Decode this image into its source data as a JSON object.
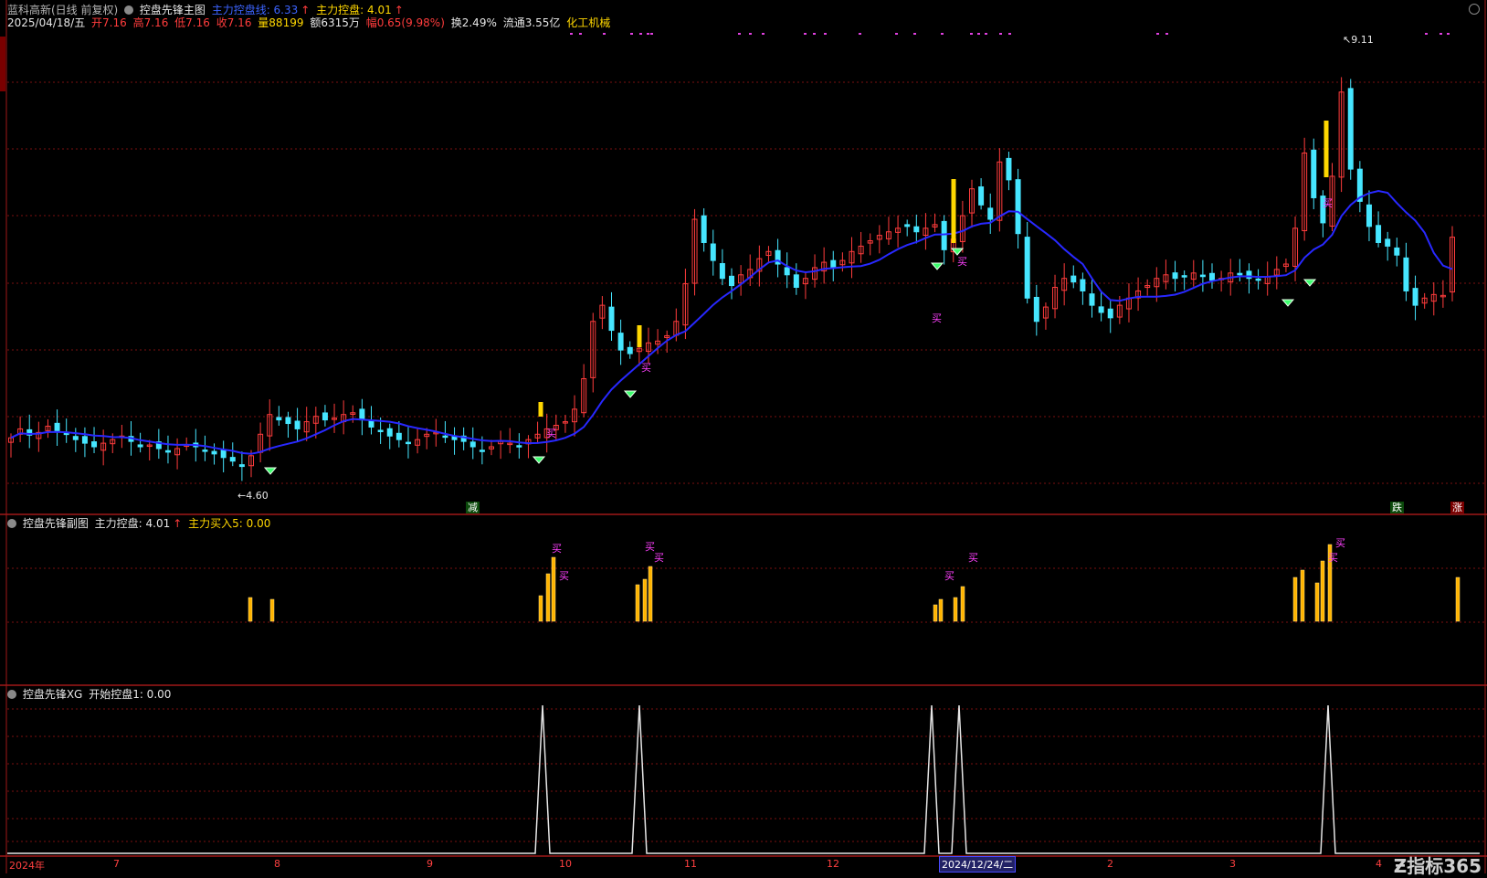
{
  "header": {
    "stock": "蓝科高新(日线 前复权)",
    "main_indicator": "控盘先锋主图",
    "line_label": "主力控盘线: 6.33",
    "kongpan_label": "主力控盘: 4.01",
    "date": "2025/04/18/五",
    "open": "开7.16",
    "high": "高7.16",
    "low": "低7.16",
    "close": "收7.16",
    "volume": "量88199",
    "amount": "额6315万",
    "change": "幅0.65(9.98%)",
    "turnover": "换2.49%",
    "float": "流通3.55亿",
    "industry": "化工机械"
  },
  "sub1": {
    "title": "控盘先锋副图",
    "kongpan": "主力控盘: 4.01",
    "buy5": "主力买入5: 0.00"
  },
  "sub2": {
    "title": "控盘先锋XG",
    "start": "开始控盘1: 0.00"
  },
  "annotations": {
    "low": "4.60",
    "high": "9.11",
    "buy": "买",
    "jian": "减",
    "die": "跌",
    "zhang": "涨"
  },
  "x_axis": {
    "labels": [
      "2024年",
      "7",
      "8",
      "9",
      "10",
      "11",
      "12",
      "2",
      "3",
      "4"
    ],
    "selected": "2024/12/24/二"
  },
  "watermark": "指标365",
  "colors": {
    "up": "#ff3c3c",
    "down": "#46e6ff",
    "ma": "#2828ff",
    "grid": "#7a1010"
  },
  "chart_data": {
    "type": "candlestick",
    "title": "蓝科高新(日线 前复权)",
    "ylim": [
      4.3,
      9.4
    ],
    "closes": [
      4.92,
      5.02,
      4.95,
      4.98,
      5.05,
      5.0,
      4.96,
      4.9,
      4.86,
      4.82,
      4.86,
      4.9,
      4.94,
      4.88,
      4.82,
      4.84,
      4.8,
      4.76,
      4.8,
      4.84,
      4.82,
      4.78,
      4.74,
      4.7,
      4.66,
      4.6,
      4.72,
      4.96,
      5.18,
      5.12,
      5.08,
      5.02,
      5.1,
      5.16,
      5.12,
      5.14,
      5.18,
      5.2,
      5.12,
      5.04,
      5.0,
      4.94,
      4.9,
      4.86,
      4.9,
      4.96,
      4.98,
      4.94,
      4.9,
      4.88,
      4.82,
      4.78,
      4.82,
      4.88,
      4.86,
      4.82,
      4.9,
      4.96,
      5.02,
      5.06,
      5.1,
      5.24,
      5.58,
      6.22,
      6.4,
      6.12,
      5.9,
      5.86,
      5.92,
      5.98,
      6.0,
      6.06,
      6.22,
      6.64,
      7.36,
      7.1,
      6.9,
      6.7,
      6.62,
      6.74,
      6.8,
      6.92,
      7.0,
      6.86,
      6.74,
      6.6,
      6.7,
      6.82,
      6.88,
      6.82,
      6.9,
      7.0,
      7.06,
      7.12,
      7.18,
      7.22,
      7.26,
      7.28,
      7.22,
      7.26,
      7.3,
      7.02,
      7.14,
      7.4,
      7.7,
      7.52,
      7.36,
      8.0,
      7.8,
      7.2,
      6.48,
      6.22,
      6.38,
      6.6,
      6.7,
      6.66,
      6.56,
      6.4,
      6.32,
      6.26,
      6.4,
      6.48,
      6.56,
      6.62,
      6.7,
      6.74,
      6.7,
      6.72,
      6.76,
      6.72,
      6.68,
      6.7,
      6.76,
      6.74,
      6.7,
      6.68,
      6.72,
      6.8,
      6.86,
      7.26,
      8.1,
      7.6,
      7.32,
      7.84,
      8.78,
      7.92,
      7.56,
      7.28,
      7.1,
      7.06,
      6.96,
      6.56,
      6.4,
      6.48,
      6.52,
      6.51,
      7.16
    ]
  }
}
